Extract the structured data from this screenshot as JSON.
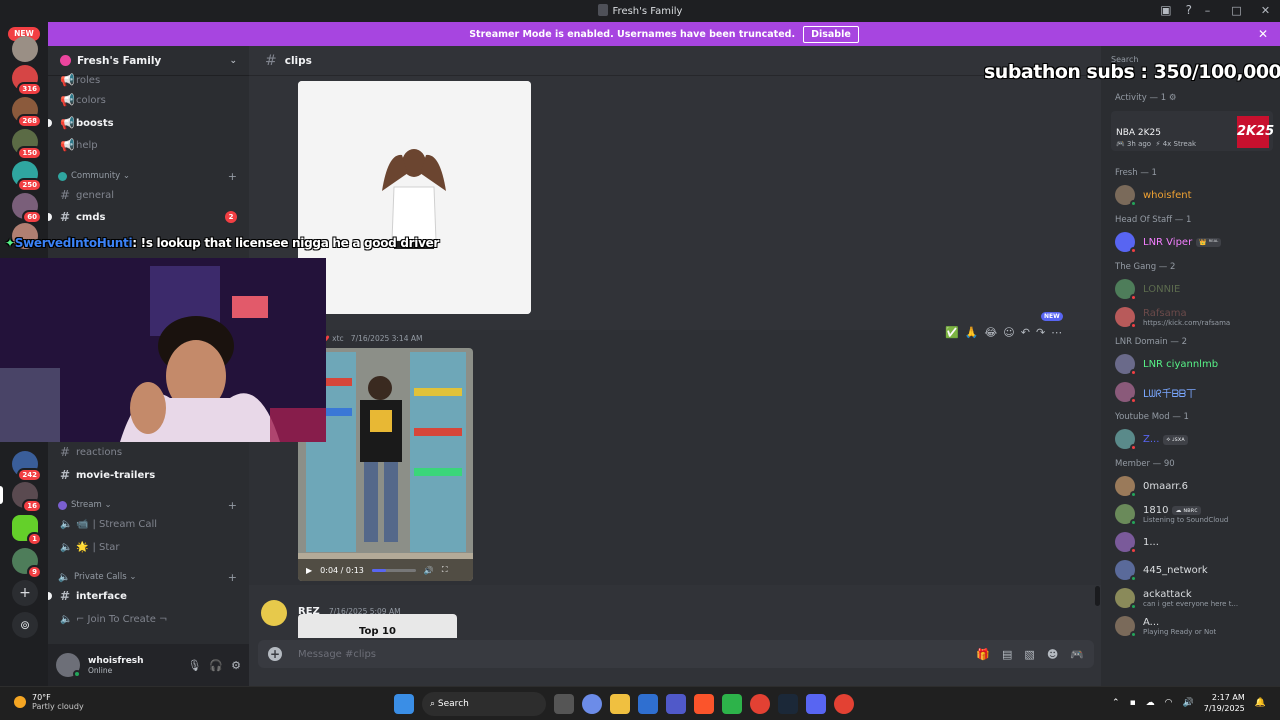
{
  "window": {
    "title": "Fresh's Family",
    "controls": [
      "–",
      "□",
      "✕"
    ]
  },
  "banner": {
    "text": "Streamer Mode is enabled. Usernames have been truncated.",
    "button": "Disable"
  },
  "servers": {
    "new_label": "NEW",
    "badges": [
      "316",
      "268",
      "150",
      "250",
      "60",
      "242",
      "16",
      "1",
      "9"
    ]
  },
  "sidebar": {
    "server_name": "Fresh's Family",
    "channels_top": [
      {
        "name": "roles",
        "type": "text"
      },
      {
        "name": "colors",
        "type": "announce"
      },
      {
        "name": "boosts",
        "type": "announce"
      },
      {
        "name": "help",
        "type": "announce"
      }
    ],
    "community_label": "Community",
    "community_channels": [
      {
        "name": "general"
      },
      {
        "name": "cmds",
        "mentions": "2"
      }
    ],
    "lower_channels": [
      {
        "name": "reactions"
      },
      {
        "name": "movie-trailers"
      }
    ],
    "stream_label": "Stream",
    "stream_channels": [
      "| Stream Call",
      "| Star"
    ],
    "private_label": "Private Calls",
    "private_channels": [
      "interface",
      "⌐ Join To Create ¬"
    ]
  },
  "user": {
    "name": "whoisfresh",
    "status": "Online"
  },
  "chat": {
    "channel": "clips",
    "msg2_time": "7/16/2025 3:14 AM",
    "msg2_tag": "xtc",
    "video_time": "0:04 / 0:13",
    "video_progress": 0.31,
    "msg3_author": "REZ",
    "msg3_time": "7/16/2025 5:09 AM",
    "preview_text": "Top 10",
    "composer_placeholder": "Message #clips",
    "toolbar_new": "NEW"
  },
  "overlay": {
    "chat_user": "SwervedIntoHunti",
    "chat_text": ": !s lookup that licensee nigga he a good driver",
    "subathon": "subathon subs : 350/100,000"
  },
  "members": {
    "search": "Search",
    "activity_header": "Activity — 1",
    "activity_game": "NBA 2K25",
    "activity_time": "3h ago",
    "activity_streak": "4x Streak",
    "nba_logo": "2K 25",
    "sections": [
      {
        "header": "Fresh — 1",
        "members": [
          {
            "name": "whoisfent",
            "color": "#f0a233",
            "status": "#23a55a"
          }
        ]
      },
      {
        "header": "Head Of Staff — 1",
        "members": [
          {
            "name": "LNR Viper",
            "color": "#f47fff",
            "status": "#f23f43",
            "tag": "👑 ᴿᴱᴬᴸ"
          }
        ]
      },
      {
        "header": "The Gang — 2",
        "members": [
          {
            "name": "LONNIE",
            "color": "#5c6b4e",
            "status": "#f23f43"
          },
          {
            "name": "Rafsama",
            "color": "#6b4a4a",
            "status": "#f23f43",
            "sub": "https://kick.com/rafsama"
          }
        ]
      },
      {
        "header": "LNR Domain — 2",
        "members": [
          {
            "name": "LNR ciyannlmb",
            "color": "#57f287",
            "status": "#f23f43"
          },
          {
            "name": "ᒪᗯᖇ千ᗷᗷ丅",
            "color": "#7aa7ff",
            "status": "#f23f43"
          }
        ]
      },
      {
        "header": "Youtube Mod — 1",
        "members": [
          {
            "name": "Z...",
            "color": "#5865f2",
            "status": "#f23f43",
            "tag": "⟡ ᴊsxᴀ"
          }
        ]
      },
      {
        "header": "Member — 90",
        "members": [
          {
            "name": "0maarr.6",
            "color": "#dbdee1",
            "status": "#23a55a"
          },
          {
            "name": "1810",
            "color": "#dbdee1",
            "status": "#23a55a",
            "tag": "☁ ɴʙʀᴄ",
            "sub": "Listening to SoundCloud"
          },
          {
            "name": "1...",
            "color": "#dbdee1",
            "status": "#f23f43"
          },
          {
            "name": "445_network",
            "color": "#dbdee1",
            "status": "#23a55a"
          },
          {
            "name": "ackattack",
            "color": "#dbdee1",
            "status": "#23a55a",
            "sub": "can i get everyone here t..."
          },
          {
            "name": "A...",
            "color": "#dbdee1",
            "status": "#23a55a",
            "sub": "Playing Ready or Not"
          }
        ]
      }
    ]
  },
  "taskbar": {
    "temp": "70°F",
    "weather": "Partly cloudy",
    "search": "Search",
    "time": "2:17 AM",
    "date": "7/19/2025"
  }
}
